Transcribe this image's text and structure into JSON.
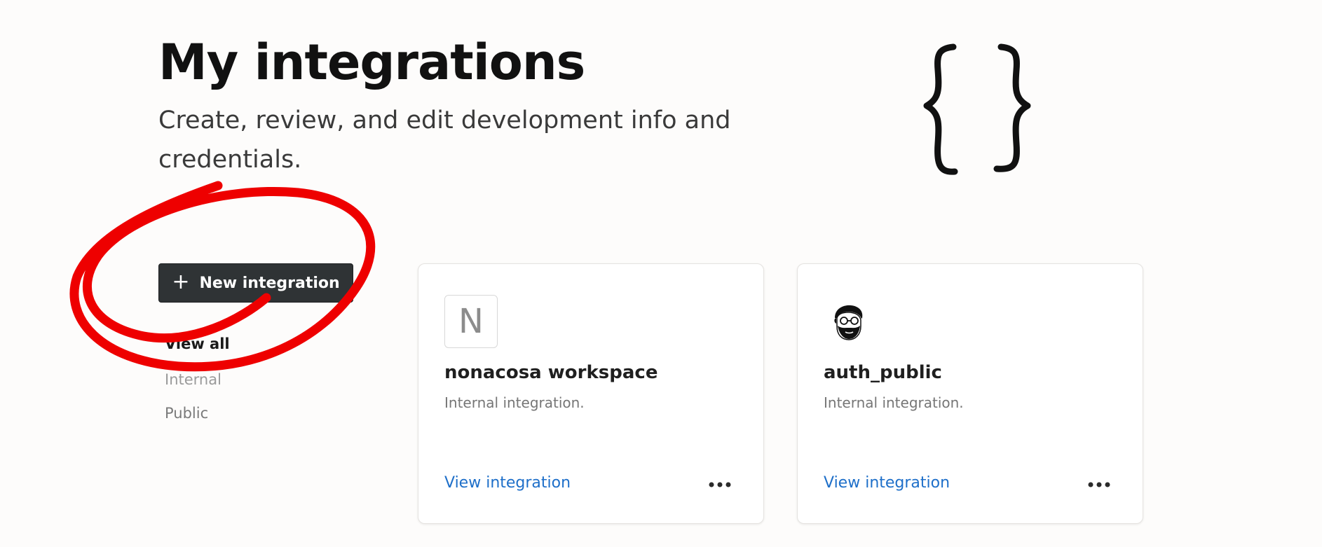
{
  "header": {
    "title": "My integrations",
    "subtitle": "Create, review, and edit development info and credentials."
  },
  "sidebar": {
    "new_button_label": "New integration",
    "filters": [
      "View all",
      "Internal",
      "Public"
    ]
  },
  "integrations": [
    {
      "logo_letter": "N",
      "name": "nonacosa workspace",
      "description": "Internal integration.",
      "link_label": "View integration"
    },
    {
      "logo_icon": "bearded-man-avatar-icon",
      "name": "auth_public",
      "description": "Internal integration.",
      "link_label": "View integration"
    }
  ],
  "colors": {
    "button_bg": "#2f3335",
    "link": "#1e6fc9",
    "annotation": "#ee0000"
  }
}
